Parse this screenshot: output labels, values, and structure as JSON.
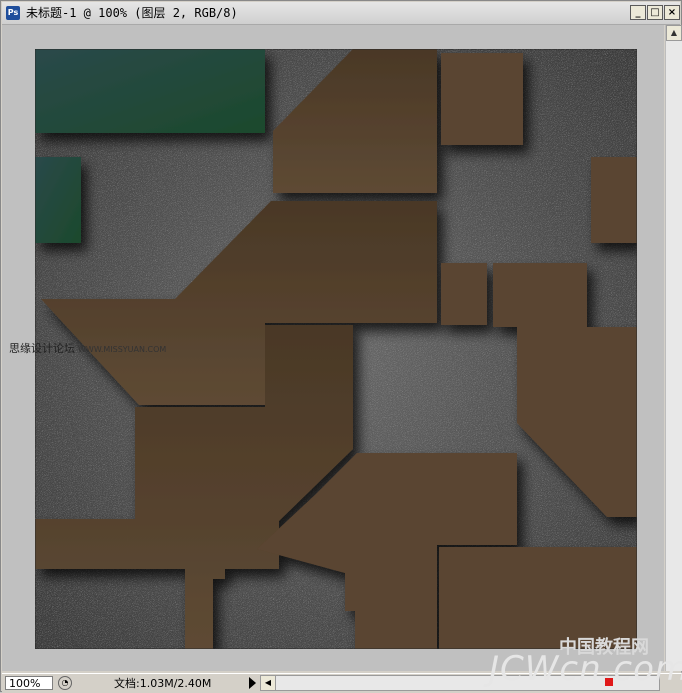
{
  "window": {
    "title": "未标题-1 @ 100% (图层 2, RGB/8)",
    "app_icon": "Ps",
    "min_label": "_",
    "max_label": "□",
    "close_label": "×"
  },
  "watermark": {
    "text": "思缘设计论坛",
    "url": "WWW.MISSYUAN.COM"
  },
  "status": {
    "zoom": "100%",
    "doc_info": "文档:1.03M/2.40M"
  },
  "brand": {
    "cn": "中国教程网",
    "en": "JCWcn.com"
  },
  "colors": {
    "canvas_bg": "#545454",
    "brown": "#5a4632",
    "green": "#1f4a34",
    "accent_red": "#e01818"
  },
  "icons": {
    "app": "photoshop-icon",
    "minimize": "minimize-icon",
    "maximize": "maximize-icon",
    "close": "close-icon",
    "scroll_up": "arrow-up-icon",
    "scroll_left": "arrow-left-icon",
    "status_arrow": "triangle-right-icon"
  }
}
